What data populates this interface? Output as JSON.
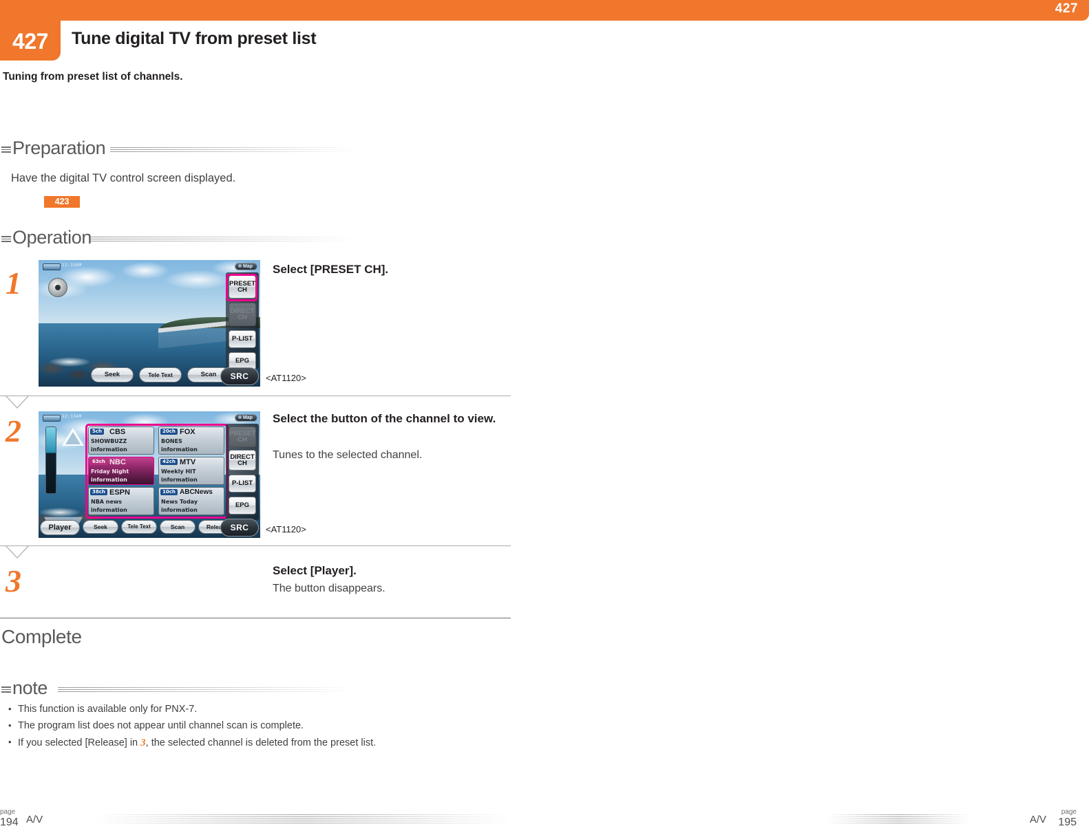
{
  "header": {
    "corner_page": "427",
    "section_number": "427",
    "title": "Tune digital TV from preset list",
    "intro": "Tuning from preset list of channels."
  },
  "preparation": {
    "heading": "Preparation",
    "text": "Have the digital TV control screen displayed.",
    "reference_page": "423"
  },
  "operation": {
    "heading": "Operation",
    "steps": [
      {
        "number": "1",
        "title": "Select [PRESET CH].",
        "sub": "",
        "model": "<AT1120>"
      },
      {
        "number": "2",
        "title": "Select the button of the channel to view.",
        "sub": "Tunes to the selected channel.",
        "model": "<AT1120>"
      },
      {
        "number": "3",
        "title": "Select [Player].",
        "sub": "The button disappears.",
        "model": ""
      }
    ]
  },
  "complete": {
    "label": "Complete"
  },
  "note": {
    "heading": "note",
    "items": [
      "This function is available only for PNX-7.",
      "The program list does not appear until channel scan is complete.",
      "If you selected [Release] in "
    ],
    "item3_ref": "3",
    "item3_tail": ", the selected channel is deleted from the preset list."
  },
  "screen1": {
    "status_time": "12:15AM",
    "map_label": "Map",
    "rail_buttons": [
      {
        "label": "PRESET CH",
        "state": "highlighted"
      },
      {
        "label": "DIRECT CH",
        "state": "disabled"
      },
      {
        "label": "P-LIST",
        "state": "normal"
      },
      {
        "label": "EPG",
        "state": "normal"
      }
    ],
    "bottom_buttons": [
      "Seek",
      "Tele Text",
      "Scan"
    ],
    "src_label": "SRC"
  },
  "screen2": {
    "status_time": "12:15AM",
    "map_label": "Map",
    "channels": [
      {
        "ch": "5ch",
        "name": "CBS",
        "desc": "SHOWBUZZ\ninformation",
        "selected": false
      },
      {
        "ch": "20ch",
        "name": "FOX",
        "desc": "BONES\ninformation",
        "selected": false
      },
      {
        "ch": "63ch",
        "name": "NBC",
        "desc": "Friday Night\ninformation",
        "selected": true
      },
      {
        "ch": "42ch",
        "name": "MTV",
        "desc": "Weekly HIT\ninformation",
        "selected": false
      },
      {
        "ch": "38ch",
        "name": "ESPN",
        "desc": "NBA news\ninformation",
        "selected": false
      },
      {
        "ch": "10ch",
        "name": "ABCNews",
        "desc": "News Today\ninformation",
        "selected": false
      }
    ],
    "rail_buttons": [
      {
        "label": "PRESET CH",
        "state": "disabled"
      },
      {
        "label": "DIRECT CH",
        "state": "normal"
      },
      {
        "label": "P-LIST",
        "state": "normal"
      },
      {
        "label": "EPG",
        "state": "normal"
      }
    ],
    "player_label": "Player",
    "bottom_buttons": [
      "Seek",
      "Tele Text",
      "Scan",
      "Release"
    ],
    "src_label": "SRC"
  },
  "footer": {
    "left_page_label": "page",
    "left_page_num": "194",
    "left_av": "A/V",
    "right_av": "A/V",
    "right_page_label": "page",
    "right_page_num": "195"
  },
  "colors": {
    "accent": "#f0772b",
    "highlight": "#ec008c",
    "heading_gray": "#58595b",
    "body_gray": "#3f3f41"
  }
}
